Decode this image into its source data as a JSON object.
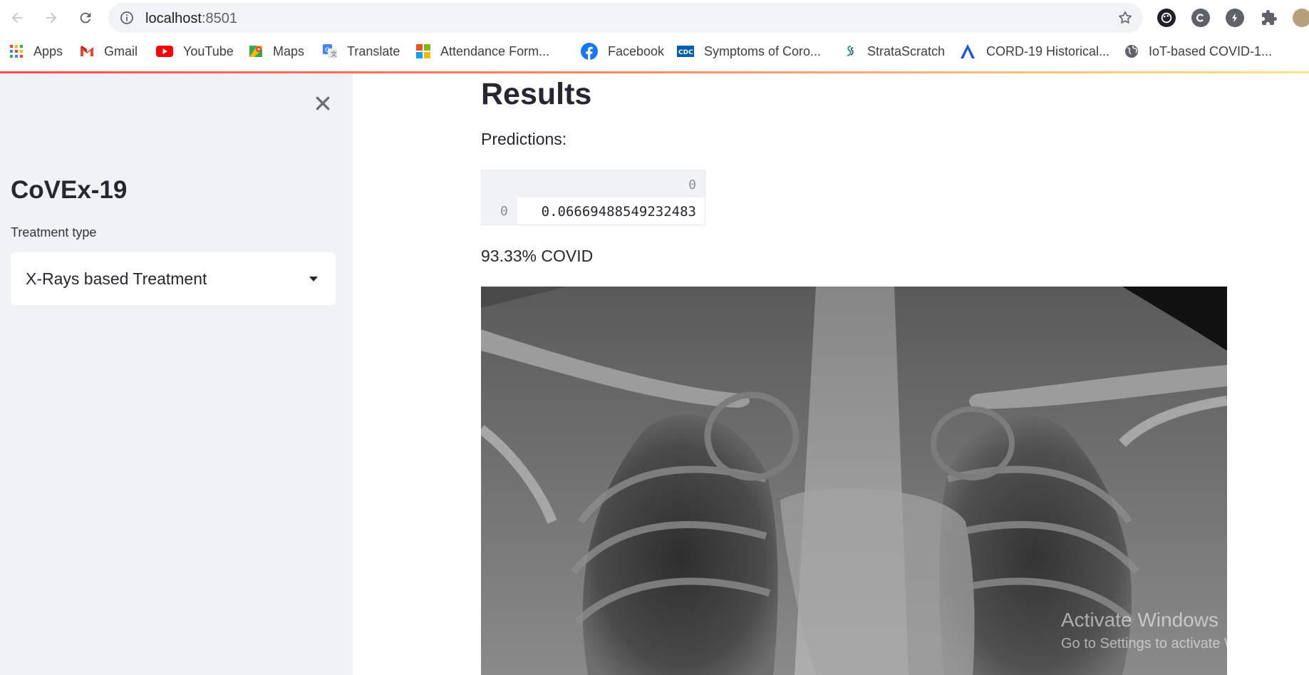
{
  "browser": {
    "url_host": "localhost",
    "url_port": ":8501",
    "bookmarks": [
      {
        "label": "Apps",
        "icon": "apps-grid-icon"
      },
      {
        "label": "Gmail",
        "icon": "gmail-icon"
      },
      {
        "label": "YouTube",
        "icon": "youtube-icon"
      },
      {
        "label": "Maps",
        "icon": "maps-icon"
      },
      {
        "label": "Translate",
        "icon": "translate-icon"
      },
      {
        "label": "Attendance Form...",
        "icon": "microsoft-icon"
      },
      {
        "label": "Facebook",
        "icon": "facebook-icon"
      },
      {
        "label": "Symptoms of Coro...",
        "icon": "cdc-icon"
      },
      {
        "label": "StrataScratch",
        "icon": "stratascratch-icon"
      },
      {
        "label": "CORD-19 Historical...",
        "icon": "cord19-icon"
      },
      {
        "label": "IoT-based COVID-1...",
        "icon": "globe-icon"
      }
    ]
  },
  "sidebar": {
    "title": "CoVEx-19",
    "select_label": "Treatment type",
    "select_value": "X-Rays based Treatment"
  },
  "main": {
    "heading": "Results",
    "predictions_label": "Predictions:",
    "dataframe": {
      "column_header": "0",
      "row_index": "0",
      "value": "0.06669488549232483"
    },
    "result_text": "93.33% COVID"
  },
  "watermark": {
    "line1": "Activate Windows",
    "line2": "Go to Settings to activate Windows."
  },
  "colors": {
    "sidebar_bg": "#f0f2f6",
    "text": "#262730",
    "accent": "#ff4b4b"
  }
}
